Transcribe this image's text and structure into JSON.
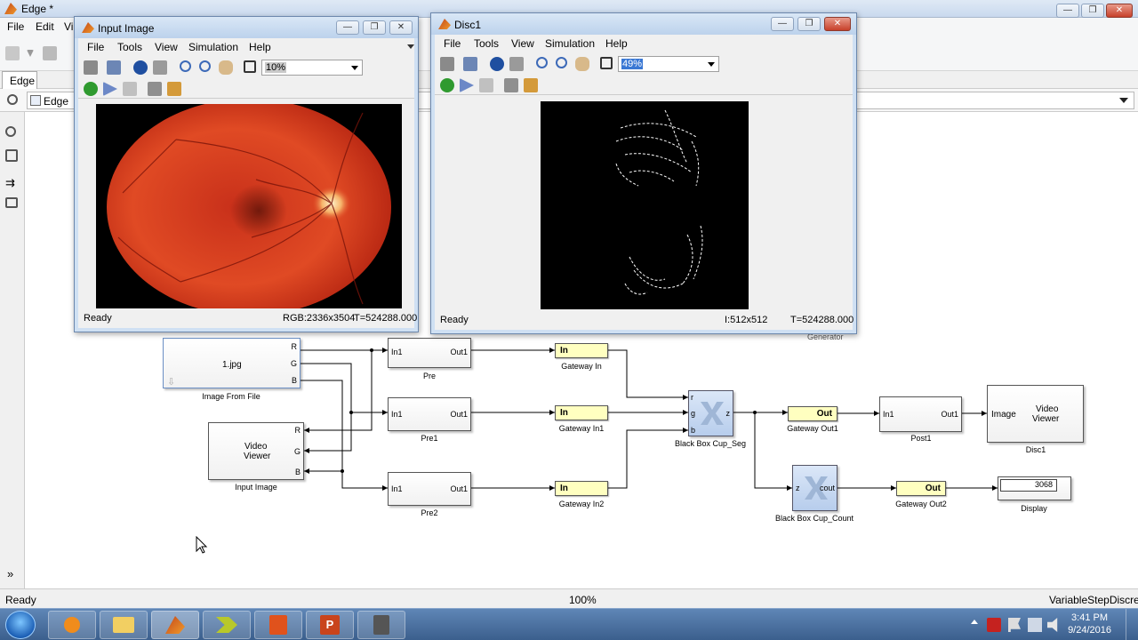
{
  "main_window": {
    "title": "Edge *",
    "menu": [
      "File",
      "Edit",
      "Vi"
    ],
    "tab": "Edge",
    "breadcrumb": "Edge"
  },
  "status": {
    "left": "Ready",
    "zoom": "100%",
    "solver": "VariableStepDiscrete"
  },
  "viewer_input": {
    "title": "Input Image",
    "menu": [
      "File",
      "Tools",
      "View",
      "Simulation",
      "Help"
    ],
    "zoom": "10%",
    "status": "Ready",
    "info": "RGB:2336x3504",
    "time": "T=524288.000"
  },
  "viewer_disc": {
    "title": "Disc1",
    "menu": [
      "File",
      "Tools",
      "View",
      "Simulation",
      "Help"
    ],
    "zoom": "49%",
    "status": "Ready",
    "info": "I:512x512",
    "time": "T=524288.000"
  },
  "blocks": {
    "image_from_file": {
      "file": "1.jpg",
      "label": "Image From File",
      "ports": [
        "R",
        "G",
        "B"
      ]
    },
    "video_viewer_input": {
      "text1": "Video",
      "text2": "Viewer",
      "label": "Input Image",
      "ports": [
        "R",
        "G",
        "B"
      ]
    },
    "pre": {
      "in": "In1",
      "out": "Out1",
      "label": "Pre"
    },
    "pre1": {
      "in": "In1",
      "out": "Out1",
      "label": "Pre1"
    },
    "pre2": {
      "in": "In1",
      "out": "Out1",
      "label": "Pre2"
    },
    "gateway_in": {
      "text": "In",
      "label": "Gateway In"
    },
    "gateway_in1": {
      "text": "In",
      "label": "Gateway In1"
    },
    "gateway_in2": {
      "text": "In",
      "label": "Gateway In2"
    },
    "black_box_seg": {
      "ports": [
        "r",
        "g",
        "b"
      ],
      "out": "z",
      "label": "Black Box Cup_Seg"
    },
    "black_box_count": {
      "in": "z",
      "out": "cout",
      "label": "Black Box Cup_Count"
    },
    "gateway_out1": {
      "text": "Out",
      "label": "Gateway Out1"
    },
    "gateway_out2": {
      "text": "Out",
      "label": "Gateway Out2"
    },
    "post1": {
      "in": "In1",
      "out": "Out1",
      "label": "Post1"
    },
    "video_viewer_disc": {
      "in": "Image",
      "text1": "Video",
      "text2": "Viewer",
      "label": "Disc1"
    },
    "display": {
      "value": "3068",
      "label": "Display"
    },
    "generator_label": "Generator"
  },
  "taskbar": {
    "time": "3:41 PM",
    "date": "9/24/2016"
  },
  "colors": {
    "gateway_fill": "#ffffc0",
    "blackbox_fill": "#c7d9f1",
    "fundus_red": "#d9381e"
  }
}
